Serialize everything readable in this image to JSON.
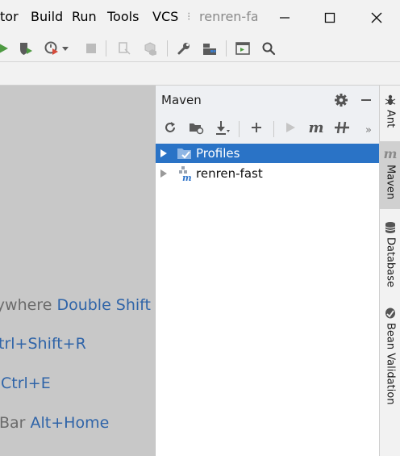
{
  "menubar": {
    "items": [
      "tor",
      "Build",
      "Run",
      "Tools",
      "VCS"
    ],
    "window_title": "renren-fas"
  },
  "editor": {
    "hints": [
      {
        "text": "ywhere ",
        "key": "Double Shift"
      },
      {
        "text": "",
        "key": "trl+Shift+R"
      },
      {
        "text": "",
        "key": "Ctrl+E"
      },
      {
        "text": "Bar ",
        "key": "Alt+Home"
      }
    ]
  },
  "maven": {
    "title": "Maven",
    "tree": [
      {
        "label": "Profiles",
        "selected": true,
        "icon": "profiles-folder-icon"
      },
      {
        "label": "renren-fast",
        "selected": false,
        "icon": "maven-module-icon"
      }
    ]
  },
  "rightbar": {
    "tabs": [
      {
        "label": "Ant",
        "icon": "ant-icon",
        "active": false
      },
      {
        "label": "Maven",
        "icon": "maven-icon",
        "active": true
      },
      {
        "label": "Database",
        "icon": "database-icon",
        "active": false
      },
      {
        "label": "Bean Validation",
        "icon": "bean-validation-icon",
        "active": false
      }
    ]
  },
  "colors": {
    "selection": "#2a73c6",
    "shortcut": "#2f64a8",
    "editor_bg": "#c8c8c8"
  }
}
